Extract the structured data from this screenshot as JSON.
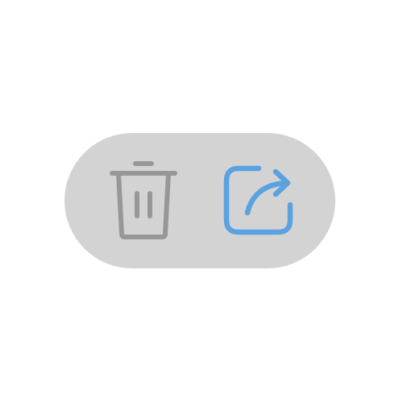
{
  "actions": [
    {
      "id": "delete",
      "icon": "trash-icon",
      "enabled": false,
      "color": "#979797"
    },
    {
      "id": "share",
      "icon": "share-arrow-icon",
      "enabled": true,
      "color": "#5aa2e0"
    }
  ],
  "colors": {
    "pill_background": "#d3d3d3",
    "page_background": "#ffffff"
  }
}
